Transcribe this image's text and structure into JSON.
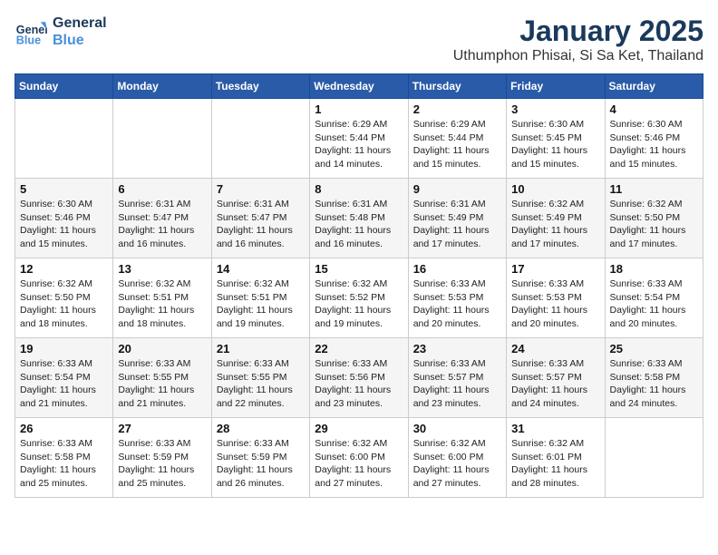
{
  "logo": {
    "line1": "General",
    "line2": "Blue"
  },
  "header": {
    "month": "January 2025",
    "location": "Uthumphon Phisai, Si Sa Ket, Thailand"
  },
  "weekdays": [
    "Sunday",
    "Monday",
    "Tuesday",
    "Wednesday",
    "Thursday",
    "Friday",
    "Saturday"
  ],
  "weeks": [
    [
      null,
      null,
      null,
      {
        "day": 1,
        "sunrise": "6:29 AM",
        "sunset": "5:44 PM",
        "daylight": "11 hours and 14 minutes."
      },
      {
        "day": 2,
        "sunrise": "6:29 AM",
        "sunset": "5:44 PM",
        "daylight": "11 hours and 15 minutes."
      },
      {
        "day": 3,
        "sunrise": "6:30 AM",
        "sunset": "5:45 PM",
        "daylight": "11 hours and 15 minutes."
      },
      {
        "day": 4,
        "sunrise": "6:30 AM",
        "sunset": "5:46 PM",
        "daylight": "11 hours and 15 minutes."
      }
    ],
    [
      {
        "day": 5,
        "sunrise": "6:30 AM",
        "sunset": "5:46 PM",
        "daylight": "11 hours and 15 minutes."
      },
      {
        "day": 6,
        "sunrise": "6:31 AM",
        "sunset": "5:47 PM",
        "daylight": "11 hours and 16 minutes."
      },
      {
        "day": 7,
        "sunrise": "6:31 AM",
        "sunset": "5:47 PM",
        "daylight": "11 hours and 16 minutes."
      },
      {
        "day": 8,
        "sunrise": "6:31 AM",
        "sunset": "5:48 PM",
        "daylight": "11 hours and 16 minutes."
      },
      {
        "day": 9,
        "sunrise": "6:31 AM",
        "sunset": "5:49 PM",
        "daylight": "11 hours and 17 minutes."
      },
      {
        "day": 10,
        "sunrise": "6:32 AM",
        "sunset": "5:49 PM",
        "daylight": "11 hours and 17 minutes."
      },
      {
        "day": 11,
        "sunrise": "6:32 AM",
        "sunset": "5:50 PM",
        "daylight": "11 hours and 17 minutes."
      }
    ],
    [
      {
        "day": 12,
        "sunrise": "6:32 AM",
        "sunset": "5:50 PM",
        "daylight": "11 hours and 18 minutes."
      },
      {
        "day": 13,
        "sunrise": "6:32 AM",
        "sunset": "5:51 PM",
        "daylight": "11 hours and 18 minutes."
      },
      {
        "day": 14,
        "sunrise": "6:32 AM",
        "sunset": "5:51 PM",
        "daylight": "11 hours and 19 minutes."
      },
      {
        "day": 15,
        "sunrise": "6:32 AM",
        "sunset": "5:52 PM",
        "daylight": "11 hours and 19 minutes."
      },
      {
        "day": 16,
        "sunrise": "6:33 AM",
        "sunset": "5:53 PM",
        "daylight": "11 hours and 20 minutes."
      },
      {
        "day": 17,
        "sunrise": "6:33 AM",
        "sunset": "5:53 PM",
        "daylight": "11 hours and 20 minutes."
      },
      {
        "day": 18,
        "sunrise": "6:33 AM",
        "sunset": "5:54 PM",
        "daylight": "11 hours and 20 minutes."
      }
    ],
    [
      {
        "day": 19,
        "sunrise": "6:33 AM",
        "sunset": "5:54 PM",
        "daylight": "11 hours and 21 minutes."
      },
      {
        "day": 20,
        "sunrise": "6:33 AM",
        "sunset": "5:55 PM",
        "daylight": "11 hours and 21 minutes."
      },
      {
        "day": 21,
        "sunrise": "6:33 AM",
        "sunset": "5:55 PM",
        "daylight": "11 hours and 22 minutes."
      },
      {
        "day": 22,
        "sunrise": "6:33 AM",
        "sunset": "5:56 PM",
        "daylight": "11 hours and 23 minutes."
      },
      {
        "day": 23,
        "sunrise": "6:33 AM",
        "sunset": "5:57 PM",
        "daylight": "11 hours and 23 minutes."
      },
      {
        "day": 24,
        "sunrise": "6:33 AM",
        "sunset": "5:57 PM",
        "daylight": "11 hours and 24 minutes."
      },
      {
        "day": 25,
        "sunrise": "6:33 AM",
        "sunset": "5:58 PM",
        "daylight": "11 hours and 24 minutes."
      }
    ],
    [
      {
        "day": 26,
        "sunrise": "6:33 AM",
        "sunset": "5:58 PM",
        "daylight": "11 hours and 25 minutes."
      },
      {
        "day": 27,
        "sunrise": "6:33 AM",
        "sunset": "5:59 PM",
        "daylight": "11 hours and 25 minutes."
      },
      {
        "day": 28,
        "sunrise": "6:33 AM",
        "sunset": "5:59 PM",
        "daylight": "11 hours and 26 minutes."
      },
      {
        "day": 29,
        "sunrise": "6:32 AM",
        "sunset": "6:00 PM",
        "daylight": "11 hours and 27 minutes."
      },
      {
        "day": 30,
        "sunrise": "6:32 AM",
        "sunset": "6:00 PM",
        "daylight": "11 hours and 27 minutes."
      },
      {
        "day": 31,
        "sunrise": "6:32 AM",
        "sunset": "6:01 PM",
        "daylight": "11 hours and 28 minutes."
      },
      null
    ]
  ]
}
